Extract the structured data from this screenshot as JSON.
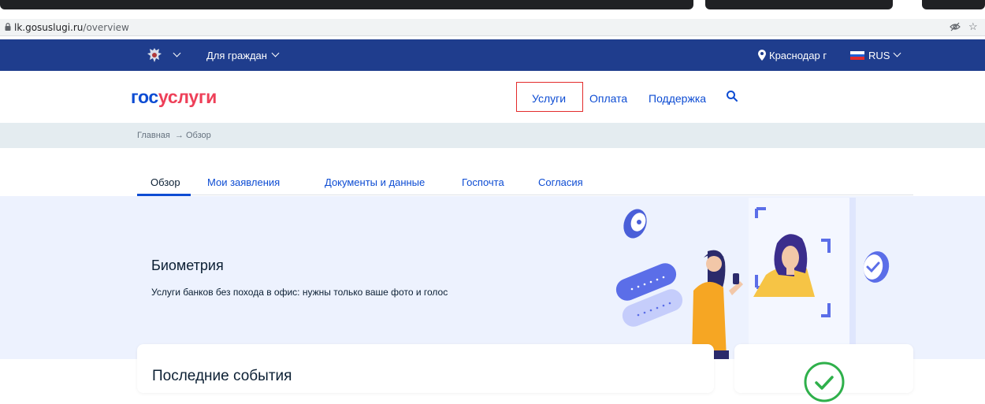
{
  "browser": {
    "url_host": "lk.gosuslugi.ru",
    "url_path": "/overview",
    "icons": [
      "lock-icon",
      "eye-off-icon",
      "star-icon"
    ]
  },
  "topnav": {
    "citizen_menu_label": "Для граждан",
    "location_label": "Краснодар г",
    "language_label": "RUS",
    "icons": [
      "emblem-icon",
      "location-pin-icon",
      "russian-flag-icon"
    ]
  },
  "header": {
    "logo_part1": "гос",
    "logo_part2": "услуги",
    "nav": {
      "services": "Услуги",
      "payment": "Оплата",
      "support": "Поддержка"
    },
    "colors": {
      "logo_blue": "#0d4cd3",
      "logo_red": "#ee3f58",
      "highlight_box": "#e32b2b"
    }
  },
  "breadcrumb": {
    "home": "Главная",
    "separator": "→",
    "current": "Обзор"
  },
  "tabs": [
    {
      "label": "Обзор",
      "active": true
    },
    {
      "label": "Мои заявления",
      "active": false
    },
    {
      "label": "Документы и данные",
      "active": false
    },
    {
      "label": "Госпочта",
      "active": false
    },
    {
      "label": "Согласия",
      "active": false
    }
  ],
  "banner": {
    "title": "Биометрия",
    "subtitle": "Услуги банков без похода в офис: нужны только ваше фото и голос",
    "illustration": "biometrics-illustration"
  },
  "events": {
    "title": "Последние события"
  },
  "colors": {
    "topnav_bg": "#1f3d8d",
    "accent": "#0d4cd3",
    "banner_bg": "#edf2fe",
    "success_green": "#2fb04b"
  }
}
